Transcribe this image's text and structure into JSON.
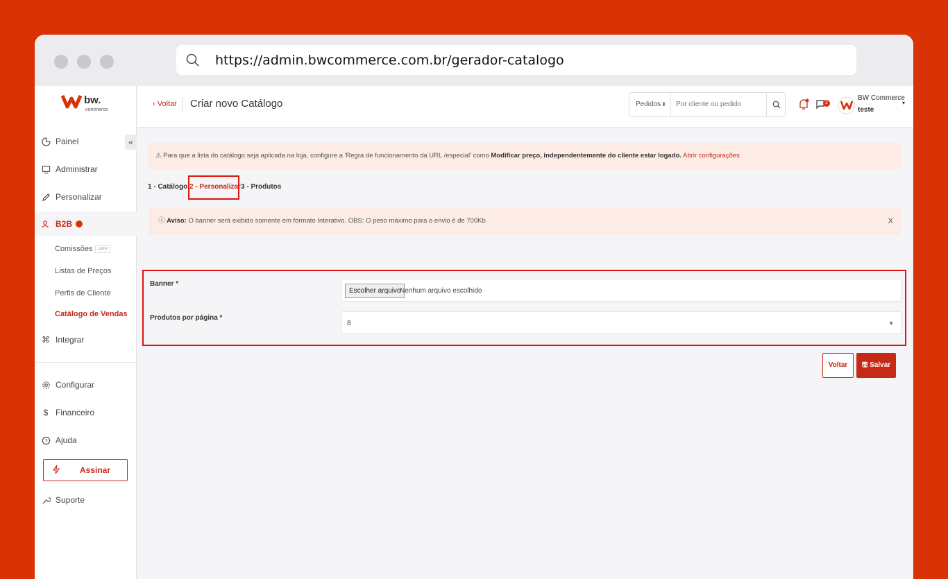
{
  "browser": {
    "url": "https://admin.bwcommerce.com.br/gerador-catalogo"
  },
  "logo": {
    "brand": "bw.",
    "brand_sub": "commerce"
  },
  "sidebar": {
    "collapse": "«",
    "items": [
      {
        "label": "Painel"
      },
      {
        "label": "Administrar"
      },
      {
        "label": "Personalizar"
      },
      {
        "label": "B2B"
      },
      {
        "label": "Integrar"
      },
      {
        "label": "Configurar"
      },
      {
        "label": "Financeiro"
      },
      {
        "label": "Ajuda"
      },
      {
        "label": "Suporte"
      }
    ],
    "b2b_sub": [
      {
        "label": "Comissões",
        "tag": "APP"
      },
      {
        "label": "Listas de Preços"
      },
      {
        "label": "Perfis de Cliente"
      },
      {
        "label": "Catálogo de Vendas"
      }
    ],
    "assinar_label": "Assinar"
  },
  "topbar": {
    "back_label": "‹ Voltar",
    "title": "Criar novo Catálogo",
    "search_select": "Pedidos",
    "search_placeholder": "Por cliente ou pedido",
    "chat_count": "2",
    "user_name": "BW Commerce",
    "user_sub": "teste"
  },
  "alert_top": {
    "text_pre": "Para que a lista do catálogo seja aplicada na loja, configure a 'Regra de funcionamento da URL /especial' como ",
    "text_bold": "Modificar preço, independentemente do cliente estar logado.",
    "link": "Abrir configurações"
  },
  "steps": [
    {
      "label": "1 - Catálogo"
    },
    {
      "label": "2 - Personalizar"
    },
    {
      "label": "3 - Produtos"
    }
  ],
  "alert_aviso": {
    "bold": "Aviso:",
    "text": "O banner será exibido somente em formato Interativo. OBS: O peso máximo para o envio é de 700Kb",
    "close": "X"
  },
  "form": {
    "banner_label": "Banner *",
    "file_button": "Escolher arquivo",
    "file_status": "Nenhum arquivo escolhido",
    "per_page_label": "Produtos por página *",
    "per_page_value": "8"
  },
  "actions": {
    "back": "Voltar",
    "save": "Salvar"
  },
  "colors": {
    "accent": "#c42a16",
    "background": "#d93205",
    "highlight_border": "#d9150b"
  }
}
